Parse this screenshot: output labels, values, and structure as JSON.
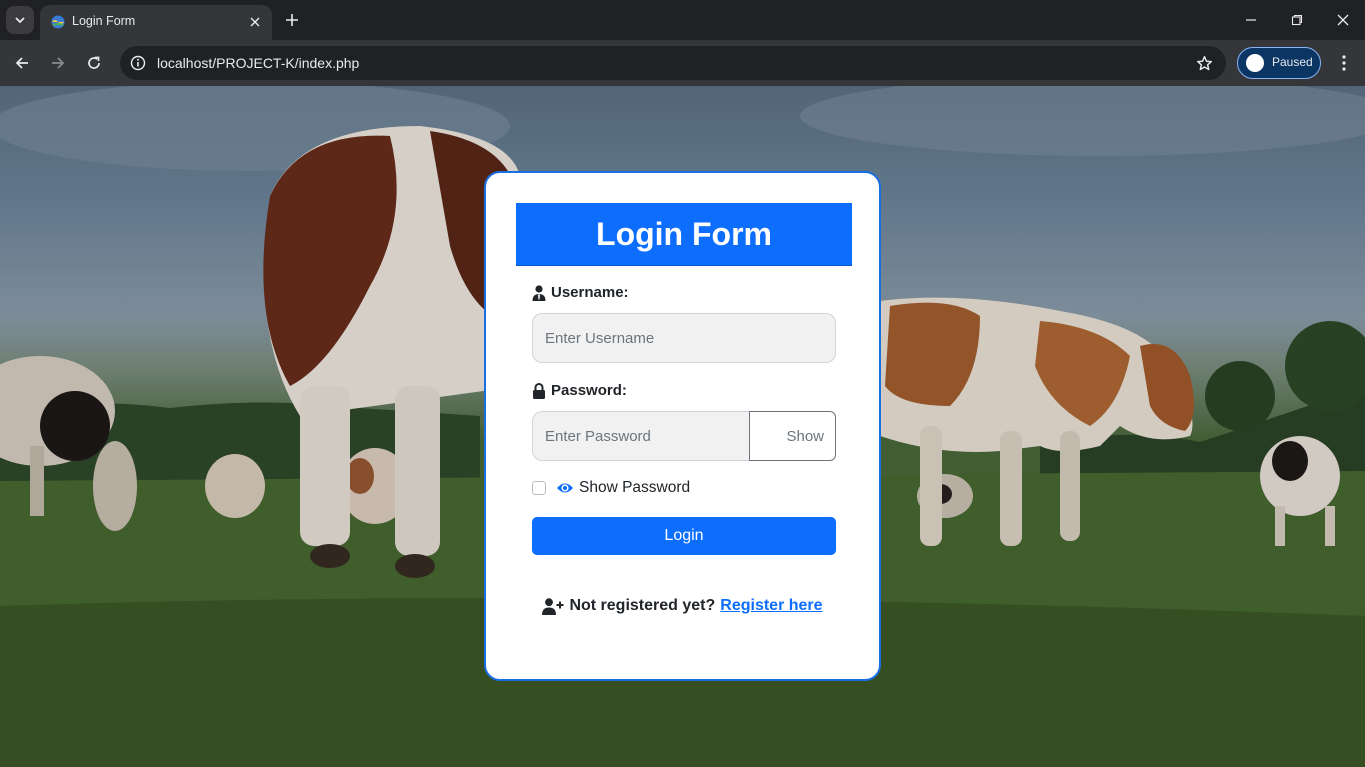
{
  "browser": {
    "tab_title": "Login Form",
    "url": "localhost/PROJECT-K/index.php",
    "profile_label": "Paused",
    "icons": [
      "tab-search-icon",
      "site-favicon-icon",
      "close-icon",
      "new-tab-icon",
      "minimize-icon",
      "maximize-icon",
      "window-close-icon",
      "back-icon",
      "forward-icon",
      "reload-icon",
      "site-info-icon",
      "bookmark-star-icon",
      "menu-kebab-icon"
    ]
  },
  "login": {
    "title": "Login Form",
    "username_label": "Username:",
    "username_placeholder": "Enter Username",
    "username_value": "",
    "password_label": "Password:",
    "password_placeholder": "Enter Password",
    "password_value": "",
    "show_button": "Show",
    "show_password_label": "Show Password",
    "show_password_checked": false,
    "login_button": "Login",
    "not_registered": "Not registered yet?",
    "register_link": "Register here"
  },
  "colors": {
    "primary": "#0d6efd",
    "card_border": "#1a6fe0",
    "browser_frame": "#202124",
    "toolbar": "#35363a"
  }
}
